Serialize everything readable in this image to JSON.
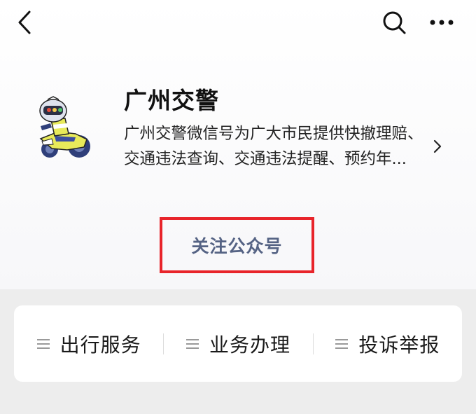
{
  "nav": {
    "back_icon": "chevron-left-icon",
    "search_icon": "search-icon",
    "more_icon": "more-dots-icon"
  },
  "account": {
    "name": "广州交警",
    "description_line1": "广州交警微信号为广大市民提供快撤理赔、",
    "description_line2": "交通违法查询、交通违法提醒、预约年...",
    "avatar_icon": "robot-police-motorcycle-avatar"
  },
  "follow": {
    "label": "关注公众号",
    "highlight_color": "#e8242a",
    "text_color": "#556384"
  },
  "menu": {
    "items": [
      {
        "label": "出行服务",
        "icon": "menu-list-icon"
      },
      {
        "label": "业务办理",
        "icon": "menu-list-icon"
      },
      {
        "label": "投诉举报",
        "icon": "menu-list-icon"
      }
    ]
  }
}
